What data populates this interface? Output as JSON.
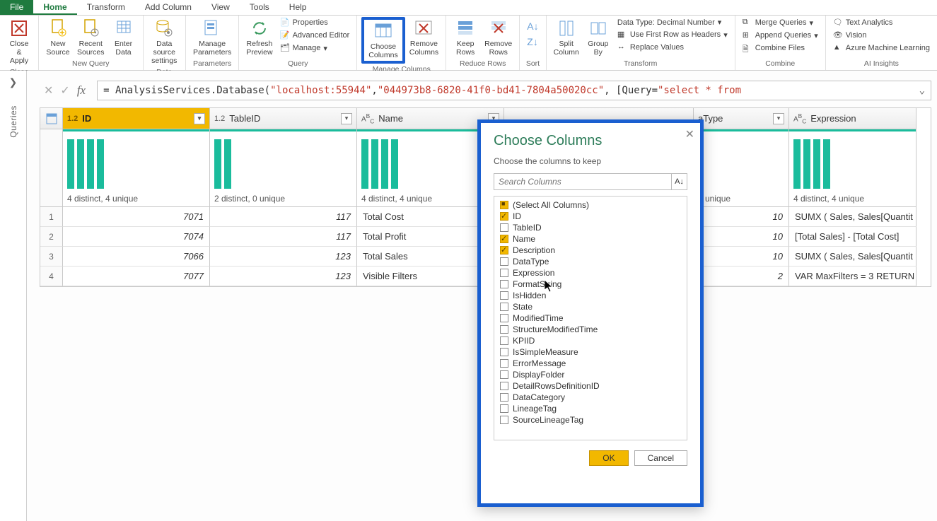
{
  "tabs": [
    "File",
    "Home",
    "Transform",
    "Add Column",
    "View",
    "Tools",
    "Help"
  ],
  "ribbon": {
    "close": {
      "close_apply": "Close &\nApply",
      "group": "Close"
    },
    "newquery": {
      "new_source": "New\nSource",
      "recent_sources": "Recent\nSources",
      "enter_data": "Enter\nData",
      "group": "New Query"
    },
    "datasources": {
      "ds_settings": "Data source\nsettings",
      "group": "Data Sources"
    },
    "params": {
      "manage_params": "Manage\nParameters",
      "group": "Parameters"
    },
    "query": {
      "refresh": "Refresh\nPreview",
      "properties": "Properties",
      "advanced": "Advanced Editor",
      "manage": "Manage",
      "group": "Query"
    },
    "manage_columns": {
      "choose": "Choose\nColumns",
      "remove": "Remove\nColumns",
      "group": "Manage Columns"
    },
    "reduce_rows": {
      "keep": "Keep\nRows",
      "remove": "Remove\nRows",
      "group": "Reduce Rows"
    },
    "sort": {
      "group": "Sort"
    },
    "transform": {
      "split": "Split\nColumn",
      "groupby": "Group\nBy",
      "datatype": "Data Type: Decimal Number",
      "firstrow": "Use First Row as Headers",
      "replace": "Replace Values",
      "group": "Transform"
    },
    "combine": {
      "merge": "Merge Queries",
      "append": "Append Queries",
      "combinefiles": "Combine Files",
      "group": "Combine"
    },
    "ai": {
      "text": "Text Analytics",
      "vision": "Vision",
      "aml": "Azure Machine Learning",
      "group": "AI Insights"
    }
  },
  "left_panel_label": "Queries",
  "formula": {
    "prefix": "= AnalysisServices.Database(",
    "s1": "\"localhost:55944\"",
    "mid1": ", ",
    "s2": "\"044973b8-6820-41f0-bd41-7804a50020cc\"",
    "mid2": ", [Query=",
    "s3": "\"select * from"
  },
  "columns": [
    {
      "name": "ID",
      "type": "1.2",
      "selected": true,
      "profile": "4 distinct, 4 unique",
      "bars": [
        70,
        70,
        70,
        70
      ]
    },
    {
      "name": "TableID",
      "type": "1.2",
      "selected": false,
      "profile": "2 distinct, 0 unique",
      "bars": [
        70,
        70
      ]
    },
    {
      "name": "Name",
      "type": "ABC",
      "selected": false,
      "profile": "4 distinct, 4 unique",
      "bars": [
        70,
        70,
        70,
        70
      ]
    },
    {
      "name": "aType",
      "type": "",
      "selected": false,
      "profile": "1 unique",
      "bars": []
    },
    {
      "name": "Expression",
      "type": "ABC",
      "selected": false,
      "profile": "4 distinct, 4 unique",
      "bars": [
        70,
        70,
        70,
        70
      ]
    }
  ],
  "rows": [
    {
      "n": 1,
      "ID": "7071",
      "TableID": "117",
      "Name": "Total Cost",
      "aType": "10",
      "Expression": "SUMX ( Sales, Sales[Quantit"
    },
    {
      "n": 2,
      "ID": "7074",
      "TableID": "117",
      "Name": "Total Profit",
      "aType": "10",
      "Expression": "[Total Sales] - [Total Cost]"
    },
    {
      "n": 3,
      "ID": "7066",
      "TableID": "123",
      "Name": "Total Sales",
      "aType": "10",
      "Expression": "SUMX ( Sales, Sales[Quantit"
    },
    {
      "n": 4,
      "ID": "7077",
      "TableID": "123",
      "Name": "Visible Filters",
      "aType": "2",
      "Expression": "VAR MaxFilters = 3 RETURN"
    }
  ],
  "dialog": {
    "title": "Choose Columns",
    "subtitle": "Choose the columns to keep",
    "search_placeholder": "Search Columns",
    "select_all": "(Select All Columns)",
    "items": [
      {
        "label": "ID",
        "checked": true
      },
      {
        "label": "TableID",
        "checked": false
      },
      {
        "label": "Name",
        "checked": true
      },
      {
        "label": "Description",
        "checked": true
      },
      {
        "label": "DataType",
        "checked": false
      },
      {
        "label": "Expression",
        "checked": false
      },
      {
        "label": "FormatString",
        "checked": false
      },
      {
        "label": "IsHidden",
        "checked": false
      },
      {
        "label": "State",
        "checked": false
      },
      {
        "label": "ModifiedTime",
        "checked": false
      },
      {
        "label": "StructureModifiedTime",
        "checked": false
      },
      {
        "label": "KPIID",
        "checked": false
      },
      {
        "label": "IsSimpleMeasure",
        "checked": false
      },
      {
        "label": "ErrorMessage",
        "checked": false
      },
      {
        "label": "DisplayFolder",
        "checked": false
      },
      {
        "label": "DetailRowsDefinitionID",
        "checked": false
      },
      {
        "label": "DataCategory",
        "checked": false
      },
      {
        "label": "LineageTag",
        "checked": false
      },
      {
        "label": "SourceLineageTag",
        "checked": false
      }
    ],
    "ok": "OK",
    "cancel": "Cancel"
  }
}
